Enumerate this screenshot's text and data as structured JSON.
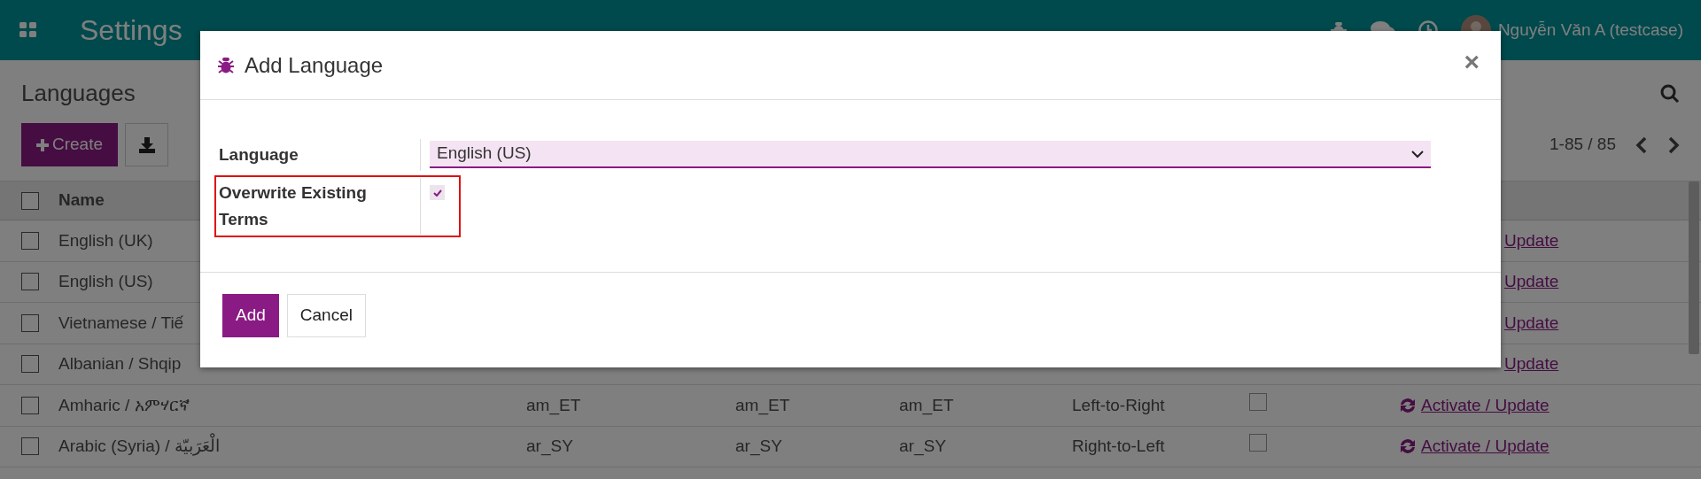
{
  "navbar": {
    "app_title": "Settings",
    "user": "Nguyễn Văn A (testcase)"
  },
  "control_panel": {
    "title": "Languages",
    "create_button": "Create",
    "pager": "1-85 / 85"
  },
  "table": {
    "header_checked": false,
    "columns": [
      "Name"
    ],
    "rows": [
      {
        "checked": false,
        "name": "English (UK)",
        "action": "Update",
        "action_icon": false
      },
      {
        "checked": false,
        "name": "English (US)",
        "action": "Update",
        "action_icon": false
      },
      {
        "checked": false,
        "name": "Vietnamese / Tiế",
        "action": "Update",
        "action_icon": false
      },
      {
        "checked": false,
        "name": "Albanian / Shqip",
        "action": "Update",
        "action_icon": false
      },
      {
        "checked": false,
        "name": "Amharic / አምሃርኛ",
        "code": "am_ET",
        "iso_code": "am_ET",
        "url_code": "am_ET",
        "direction": "Left-to-Right",
        "active": false,
        "action": "Activate / Update",
        "action_icon": true
      },
      {
        "checked": false,
        "name": "Arabic (Syria) / الْعَرَبيّة",
        "code": "ar_SY",
        "iso_code": "ar_SY",
        "url_code": "ar_SY",
        "direction": "Right-to-Left",
        "active": false,
        "action": "Activate / Update",
        "action_icon": true
      }
    ]
  },
  "dialog": {
    "title": "Add Language",
    "close": "×",
    "fields": [
      {
        "kind": "select",
        "label": "Language",
        "value": "English (US)"
      },
      {
        "kind": "checkbox",
        "label": "Overwrite Existing Terms",
        "checked": true,
        "highlighted": true
      }
    ],
    "buttons": [
      {
        "label": "Add",
        "primary": true
      },
      {
        "label": "Cancel",
        "primary": false
      }
    ]
  }
}
